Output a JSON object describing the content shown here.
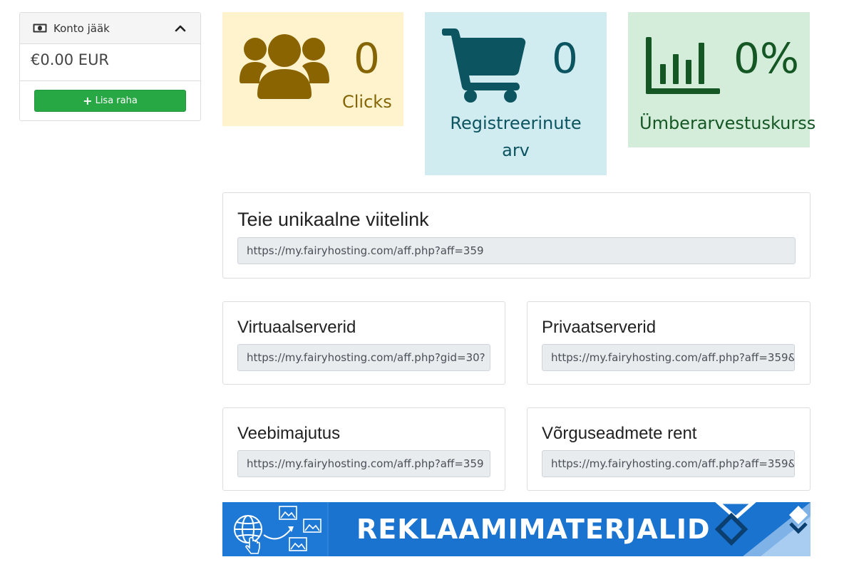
{
  "balance": {
    "title": "Konto jääk",
    "amount": "€0.00 EUR",
    "add_funds_label": "Lisa raha"
  },
  "stats": {
    "clicks": {
      "value": "0",
      "label": "Clicks",
      "color": "#856404",
      "bg": "#fff3cd"
    },
    "signups": {
      "value": "0",
      "label_line1": "Registreerinute",
      "label_line2": "arv",
      "color": "#0c5460",
      "bg": "#d1ecf1"
    },
    "conversion": {
      "value": "0%",
      "label": "Ümberarvestuskurss",
      "color": "#155724",
      "bg": "#d4edda"
    }
  },
  "referral": {
    "title": "Teie unikaalne viitelink",
    "url": "https://my.fairyhosting.com/aff.php?aff=359"
  },
  "product_links": [
    {
      "title": "Virtuaalserverid",
      "url": "https://my.fairyhosting.com/aff.php?gid=30?"
    },
    {
      "title": "Privaatserverid",
      "url": "https://my.fairyhosting.com/aff.php?aff=359&"
    },
    {
      "title": "Veebimajutus",
      "url": "https://my.fairyhosting.com/aff.php?aff=359"
    },
    {
      "title": "Võrguseadmete rent",
      "url": "https://my.fairyhosting.com/aff.php?aff=359&"
    }
  ],
  "banner": {
    "text": "REKLAAMIMATERJALID",
    "bg_color": "#1b73d0"
  },
  "icons": {
    "balance": "money-icon",
    "collapse": "chevron-up-icon",
    "add": "plus-icon",
    "clicks": "users-icon",
    "signups": "shopping-cart-icon",
    "conversion": "bar-chart-icon",
    "banner": "globe-images-icon"
  }
}
